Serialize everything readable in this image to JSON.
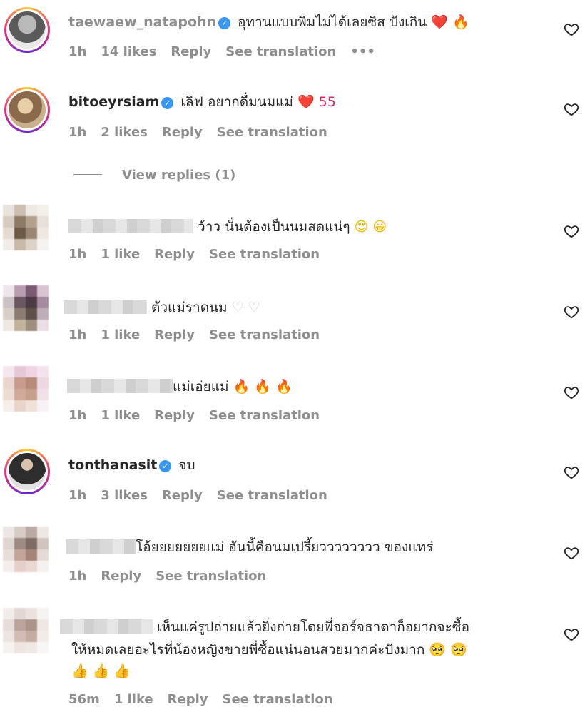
{
  "comments": [
    {
      "username": "taewaew_natapohn",
      "verified": true,
      "text": "อุทานแบบพิมไม่ได้เลยซิส ปังเกิน",
      "emoji": "❤️ 🔥",
      "time": "1h",
      "likes": "14 likes",
      "reply": "Reply",
      "translate": "See translation",
      "more": "•••"
    },
    {
      "username": "bitoeyrsiam",
      "verified": true,
      "text": "เลิฟ อยากดื่มนมแม่",
      "emoji": "❤️ 55",
      "time": "1h",
      "likes": "2 likes",
      "reply": "Reply",
      "translate": "See translation"
    },
    {
      "username": "",
      "verified": false,
      "text": "ว้าว นั่นต้องเป็นนมสดแน่ๆ",
      "emoji": "😍 😀",
      "time": "1h",
      "likes": "1 like",
      "reply": "Reply",
      "translate": "See translation"
    },
    {
      "username": "",
      "verified": false,
      "text": "ตัวแม่ราดนม",
      "emoji": "♡ ♡",
      "time": "1h",
      "likes": "1 like",
      "reply": "Reply",
      "translate": "See translation"
    },
    {
      "username": "",
      "verified": false,
      "text": "แม่เอ่ยแม่",
      "emoji": "🔥 🔥 🔥",
      "time": "1h",
      "likes": "1 like",
      "reply": "Reply",
      "translate": "See translation"
    },
    {
      "username": "tonthanasit",
      "verified": true,
      "text": "จบ",
      "emoji": "",
      "time": "1h",
      "likes": "3 likes",
      "reply": "Reply",
      "translate": "See translation"
    },
    {
      "username": "",
      "verified": false,
      "text": "โอ้ยยยยยยยแม่ อันนี้คือนมเปรี้ยวววววววว ของแทร่",
      "emoji": "",
      "time": "1h",
      "likes": "",
      "reply": "Reply",
      "translate": "See translation"
    },
    {
      "username": "",
      "verified": false,
      "text": "เห็นแค่รูปถ่ายแล้วยิ่งถ่ายโดยพี่จอร์จธาดาก็อยากจะซื้อ",
      "text2": "ให้หมดเลยอะไรที่น้องหญิงขายพี่ซื้อแน่นอนสวยมากค่ะปังมาก",
      "emoji": "🥺 🥺",
      "emoji2": "👍 👍 👍",
      "time": "56m",
      "likes": "1 like",
      "reply": "Reply",
      "translate": "See translation"
    }
  ],
  "view_replies": "View replies (1)",
  "icons": {
    "heart": "heart-outline-icon",
    "verified": "verified-badge-icon"
  },
  "colors": {
    "meta": "#8e8e8e",
    "verified": "#3897f0",
    "text": "#262626"
  }
}
